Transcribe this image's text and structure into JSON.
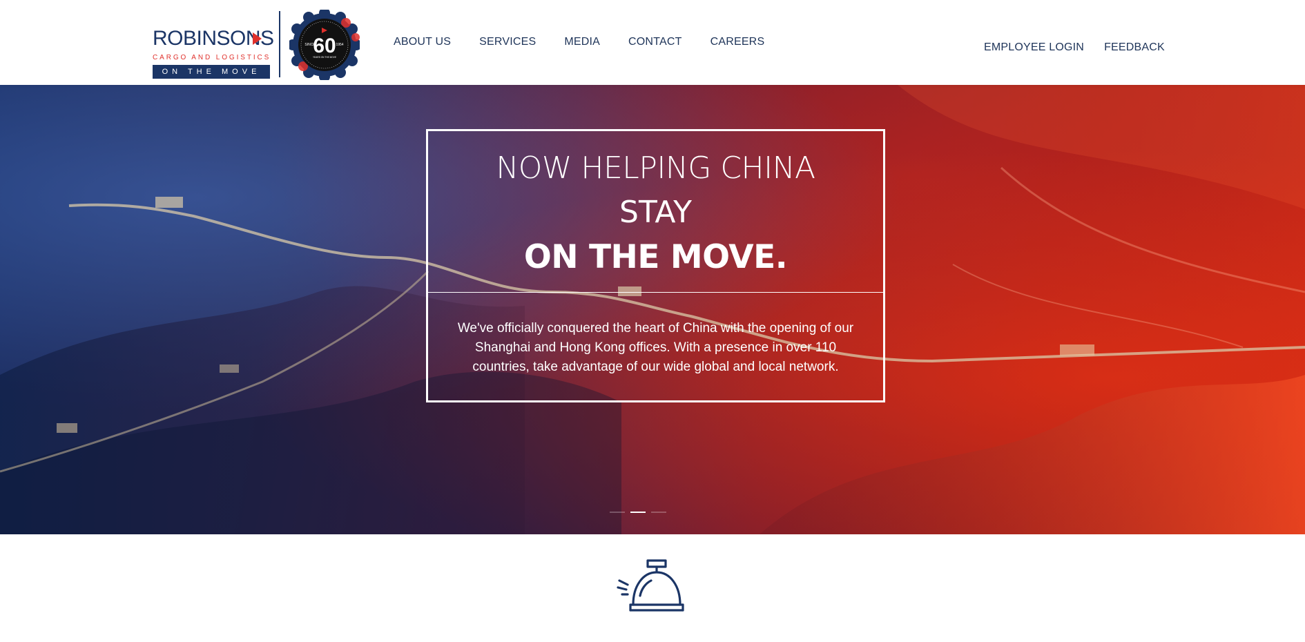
{
  "brand": {
    "name": "ROBINSONS",
    "subtitle": "CARGO AND LOGISTICS",
    "tagline": "ON THE MOVE",
    "badge": {
      "since_label": "SINCE",
      "years": "60",
      "founded": "1954",
      "caption": "YEARS ON THE MOVE"
    },
    "colors": {
      "navy": "#1b3566",
      "red": "#e0302b"
    }
  },
  "nav": {
    "items": [
      {
        "label": "ABOUT US"
      },
      {
        "label": "SERVICES"
      },
      {
        "label": "MEDIA"
      },
      {
        "label": "CONTACT"
      },
      {
        "label": "CAREERS"
      }
    ]
  },
  "utility_nav": {
    "items": [
      {
        "label": "EMPLOYEE LOGIN"
      },
      {
        "label": "FEEDBACK"
      }
    ]
  },
  "hero": {
    "headline_line1": "NOW HELPING CHINA",
    "headline_line2": "STAY",
    "headline_line3": "ON THE MOVE.",
    "body": "We've officially conquered the heart of China with the opening of our Shanghai and Hong Kong offices. With a presence in over 110 countries, take advantage of our wide global and local network.",
    "slides_total": 3,
    "active_slide": 1
  },
  "services": {
    "icon": "service-bell-icon"
  }
}
